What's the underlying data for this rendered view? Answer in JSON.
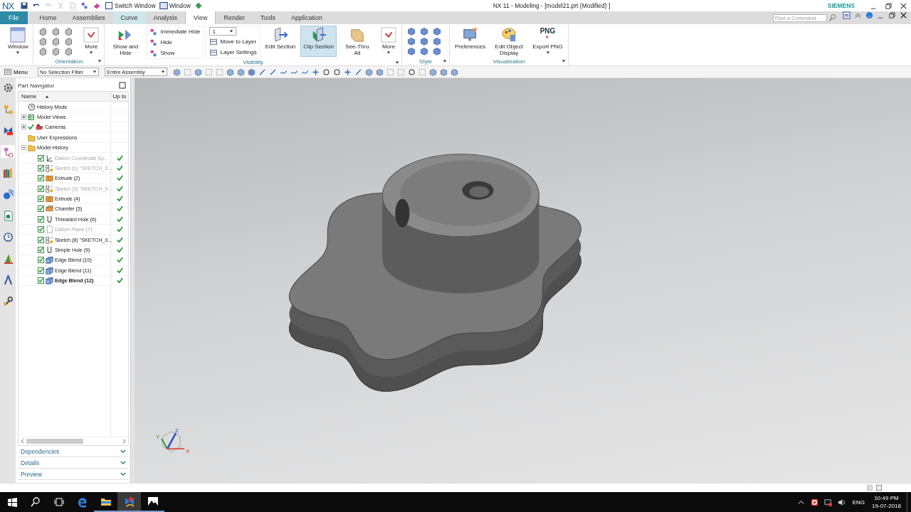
{
  "title_bar": {
    "logo": "NX",
    "switch_window": "Switch Window",
    "window_menu": "Window",
    "title": "NX 11 - Modeling - [model21.prt (Modified) ]",
    "brand": "SIEMENS"
  },
  "ribbon_tabs": [
    {
      "label": "File",
      "kind": "file",
      "selected": false,
      "highlighted": false
    },
    {
      "label": "Home",
      "kind": "tab",
      "selected": false,
      "highlighted": false
    },
    {
      "label": "Assemblies",
      "kind": "tab",
      "selected": false,
      "highlighted": false
    },
    {
      "label": "Curve",
      "kind": "tab",
      "selected": false,
      "highlighted": true
    },
    {
      "label": "Analysis",
      "kind": "tab",
      "selected": false,
      "highlighted": false
    },
    {
      "label": "View",
      "kind": "tab",
      "selected": true,
      "highlighted": false
    },
    {
      "label": "Render",
      "kind": "tab",
      "selected": false,
      "highlighted": false
    },
    {
      "label": "Tools",
      "kind": "tab",
      "selected": false,
      "highlighted": false
    },
    {
      "label": "Application",
      "kind": "tab",
      "selected": false,
      "highlighted": false
    }
  ],
  "command_search": {
    "placeholder": "Find a Command"
  },
  "ribbon_groups": [
    {
      "items": [
        {
          "kind": "window",
          "label": "Window",
          "dropdown": true,
          "selected": false
        }
      ]
    },
    {
      "label": "Orientation",
      "items": [
        {
          "kind": "orientation"
        },
        {
          "kind": "more",
          "label": "More",
          "dropdown": true,
          "selected": false
        }
      ]
    },
    {
      "label": "Visibility",
      "items": [
        {
          "kind": "showhide",
          "label": "Show and Hide",
          "selected": false
        },
        {
          "kind": "hidelist",
          "entries": [
            "Immediate Hide",
            "Hide",
            "Show"
          ]
        },
        {
          "kind": "layer",
          "value": "1",
          "entries": [
            "Move to Layer",
            "Layer Settings"
          ]
        },
        {
          "kind": "section",
          "label": "Edit Section",
          "selected": false
        },
        {
          "kind": "clip",
          "label": "Clip Section",
          "selected": true
        },
        {
          "kind": "seethru",
          "label": "See-Thru All",
          "selected": false
        },
        {
          "kind": "more",
          "label": "More",
          "dropdown": true,
          "selected": false
        }
      ]
    },
    {
      "label": "Style",
      "items": [
        {
          "kind": "style"
        }
      ]
    },
    {
      "label": "Visualization",
      "items": [
        {
          "kind": "preferences",
          "label": "Preferences",
          "selected": false
        },
        {
          "kind": "display",
          "label": "Edit Object Display",
          "selected": false
        },
        {
          "kind": "export",
          "label": "Export PNG",
          "icon_text": "PNG",
          "dropdown": true,
          "selected": false
        }
      ]
    }
  ],
  "toolbar": {
    "menu": "Menu",
    "selection_filter": "No Selection Filter",
    "scope": "Entire Assembly"
  },
  "resource_bar": [
    {
      "kind": "gear",
      "selected": false
    },
    {
      "kind": "assembly",
      "selected": false
    },
    {
      "kind": "constraint",
      "selected": false
    },
    {
      "kind": "part",
      "selected": true
    },
    {
      "kind": "library",
      "selected": false
    },
    {
      "kind": "info",
      "selected": false
    },
    {
      "kind": "web",
      "selected": false
    },
    {
      "kind": "history",
      "selected": false
    },
    {
      "kind": "roles",
      "selected": false
    },
    {
      "kind": "tools",
      "selected": false
    },
    {
      "kind": "wrench",
      "selected": false
    }
  ],
  "navigator": {
    "title": "Part Navigator",
    "columns": [
      "Name",
      "Up to"
    ],
    "tree": [
      {
        "label": "History Mode",
        "kind": "clock",
        "checked": false
      },
      {
        "label": "Model Views",
        "kind": "views",
        "checked": false,
        "expanded": false
      },
      {
        "label": "Cameras",
        "kind": "camera",
        "checked": true,
        "expanded": false
      },
      {
        "label": "User Expressions",
        "kind": "folder",
        "checked": false
      },
      {
        "label": "Model History",
        "kind": "folder",
        "checked": false,
        "expanded": true,
        "children": [
          {
            "label": "Datum Coordinate Sy...",
            "kind": "csys",
            "checked": true,
            "greyed": true,
            "current": false,
            "up_to_date": true
          },
          {
            "label": "Sketch (1) \"SKETCH_0...",
            "kind": "sketch",
            "checked": true,
            "greyed": true,
            "current": false,
            "up_to_date": true
          },
          {
            "label": "Extrude (2)",
            "kind": "extrude",
            "checked": true,
            "greyed": false,
            "current": false,
            "up_to_date": true
          },
          {
            "label": "Sketch (3) \"SKETCH_0...",
            "kind": "sketch",
            "checked": true,
            "greyed": true,
            "current": false,
            "up_to_date": true
          },
          {
            "label": "Extrude (4)",
            "kind": "extrude",
            "checked": true,
            "greyed": false,
            "current": false,
            "up_to_date": true
          },
          {
            "label": "Chamfer (5)",
            "kind": "chamfer",
            "checked": true,
            "greyed": false,
            "current": false,
            "up_to_date": true
          },
          {
            "label": "Threaded Hole (6)",
            "kind": "hole",
            "checked": true,
            "greyed": false,
            "current": false,
            "up_to_date": true
          },
          {
            "label": "Datum Plane (7)",
            "kind": "plane",
            "checked": true,
            "greyed": true,
            "current": false,
            "up_to_date": true
          },
          {
            "label": "Sketch (8) \"SKETCH_0...",
            "kind": "sketch",
            "checked": true,
            "greyed": false,
            "current": false,
            "up_to_date": true
          },
          {
            "label": "Simple Hole (9)",
            "kind": "hole",
            "checked": true,
            "greyed": false,
            "current": false,
            "up_to_date": true
          },
          {
            "label": "Edge Blend (10)",
            "kind": "blend",
            "checked": true,
            "greyed": false,
            "current": false,
            "up_to_date": true
          },
          {
            "label": "Edge Blend (11)",
            "kind": "blend",
            "checked": true,
            "greyed": false,
            "current": false,
            "up_to_date": true
          },
          {
            "label": "Edge Blend (12)",
            "kind": "blend",
            "checked": true,
            "greyed": false,
            "current": true,
            "up_to_date": true
          }
        ]
      }
    ],
    "panels": [
      {
        "label": "Dependencies",
        "expanded": false
      },
      {
        "label": "Details",
        "expanded": false
      },
      {
        "label": "Preview",
        "expanded": false
      }
    ]
  },
  "triad": {
    "axes": [
      "X",
      "Y",
      "Z"
    ]
  },
  "taskbar": {
    "apps": [
      {
        "kind": "start",
        "running": false,
        "selected": false
      },
      {
        "kind": "search",
        "running": false,
        "selected": false
      },
      {
        "kind": "taskview",
        "running": false,
        "selected": false
      },
      {
        "kind": "edge",
        "running": false,
        "selected": false
      },
      {
        "kind": "explorer",
        "running": true,
        "selected": false
      },
      {
        "kind": "nx",
        "running": true,
        "selected": true
      },
      {
        "kind": "photos",
        "running": true,
        "selected": false
      }
    ],
    "language": "ENG",
    "time": "10:49 PM",
    "date": "19-07-2018"
  }
}
